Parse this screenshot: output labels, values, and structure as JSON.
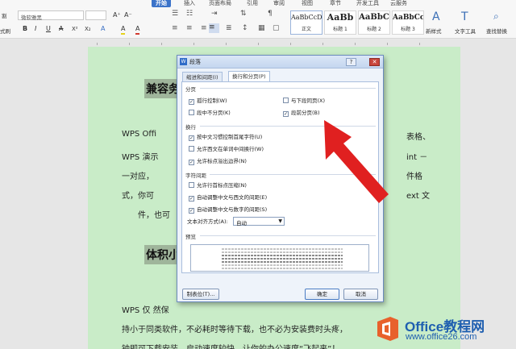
{
  "ribbon": {
    "tabs": [
      "开始",
      "插入",
      "页面布局",
      "引用",
      "审阅",
      "视图",
      "章节",
      "开发工具",
      "云服务"
    ],
    "active_tab": "开始",
    "left_label_top": "割",
    "left_label_bottom": "式刷",
    "font_name": "微软雅黑",
    "font_size": "",
    "grow_font": "A⁺",
    "shrink_font": "A⁻",
    "format_buttons": [
      "B",
      "I",
      "U",
      "A",
      "X²",
      "X₂",
      "A",
      "A",
      "A"
    ],
    "styles": [
      {
        "sample": "AaBbCcDd",
        "name": "正文"
      },
      {
        "sample": "AaBb",
        "name": "标题 1"
      },
      {
        "sample": "AaBbC",
        "name": "标题 2"
      },
      {
        "sample": "AaBbCc",
        "name": "标题 3"
      }
    ],
    "new_style": "新样式",
    "text_tools": "文字工具",
    "find_replace": "查找替换"
  },
  "document": {
    "heading1": "兼容务",
    "heading2": "体积小",
    "lines": [
      {
        "left": "WPS Offi",
        "right": "表格、"
      },
      {
        "left": "WPS 演示",
        "right": "int －"
      },
      {
        "left": "一对应，",
        "right": "件格"
      },
      {
        "left": "式，你可",
        "right": "ext 文"
      },
      {
        "left": "件，也可",
        "right": ""
      }
    ],
    "bottom_lines": [
      "WPS 仅                                                    然保",
      "持小于同类软件，不必耗时等待下载，也不必为安装费时头疼，",
      "钟即可下载安装，启动速度较快，让你的办公速度“飞起来”！"
    ]
  },
  "dialog": {
    "title": "段落",
    "tabs": [
      "缩进和间距(I)",
      "换行和分页(P)"
    ],
    "active_tab": 1,
    "sections": {
      "pagination": "分页",
      "line_break": "换行",
      "char_spacing": "字符间距",
      "preview": "预览"
    },
    "pagination_options": [
      {
        "label": "孤行控制(W)",
        "checked": true
      },
      {
        "label": "与下段同页(X)",
        "checked": false
      },
      {
        "label": "段中不分页(K)",
        "checked": false
      },
      {
        "label": "段前分页(B)",
        "checked": true
      }
    ],
    "line_break_options": [
      {
        "label": "按中文习惯控制首尾字符(U)",
        "checked": true
      },
      {
        "label": "允许西文在单词中间换行(W)",
        "checked": false
      },
      {
        "label": "允许标点溢出边界(N)",
        "checked": true
      }
    ],
    "spacing_options": [
      {
        "label": "允许行首标点压缩(N)",
        "checked": false
      },
      {
        "label": "自动调整中文与西文的间距(E)",
        "checked": true
      },
      {
        "label": "自动调整中文与数字的间距(S)",
        "checked": true
      }
    ],
    "text_align_label": "文本对齐方式(A):",
    "text_align_value": "自动",
    "tab_stops_button": "制表位(T)...",
    "ok_button": "确定",
    "cancel_button": "取消"
  },
  "watermark": {
    "brand": "Office教程网",
    "url": "www.office26.com"
  },
  "colors": {
    "page_bg": "#c9ecc8",
    "accent": "#3b73c9",
    "arrow": "#e02020"
  }
}
